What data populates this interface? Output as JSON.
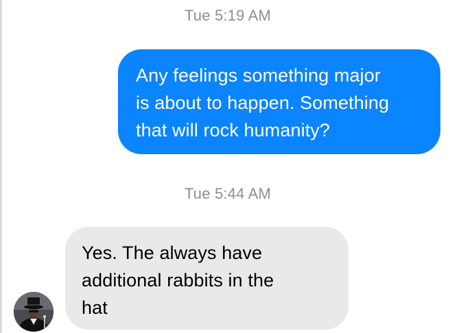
{
  "conversation": {
    "messages": [
      {
        "timestamp": "Tue 5:19 AM",
        "direction": "outgoing",
        "lines": [
          "Any feelings something major",
          "is about to happen. Something",
          "that will rock humanity?"
        ]
      },
      {
        "timestamp": "Tue 5:44 AM",
        "direction": "incoming",
        "lines": [
          "Yes. The always have",
          "additional rabbits in the",
          "hat"
        ]
      }
    ]
  },
  "colors": {
    "outgoing_bubble": "#0a84ff",
    "incoming_bubble": "#e9e9eb",
    "timestamp_text": "#8e8e93"
  },
  "icons": {
    "contact_avatar": "contact-avatar-icon"
  }
}
